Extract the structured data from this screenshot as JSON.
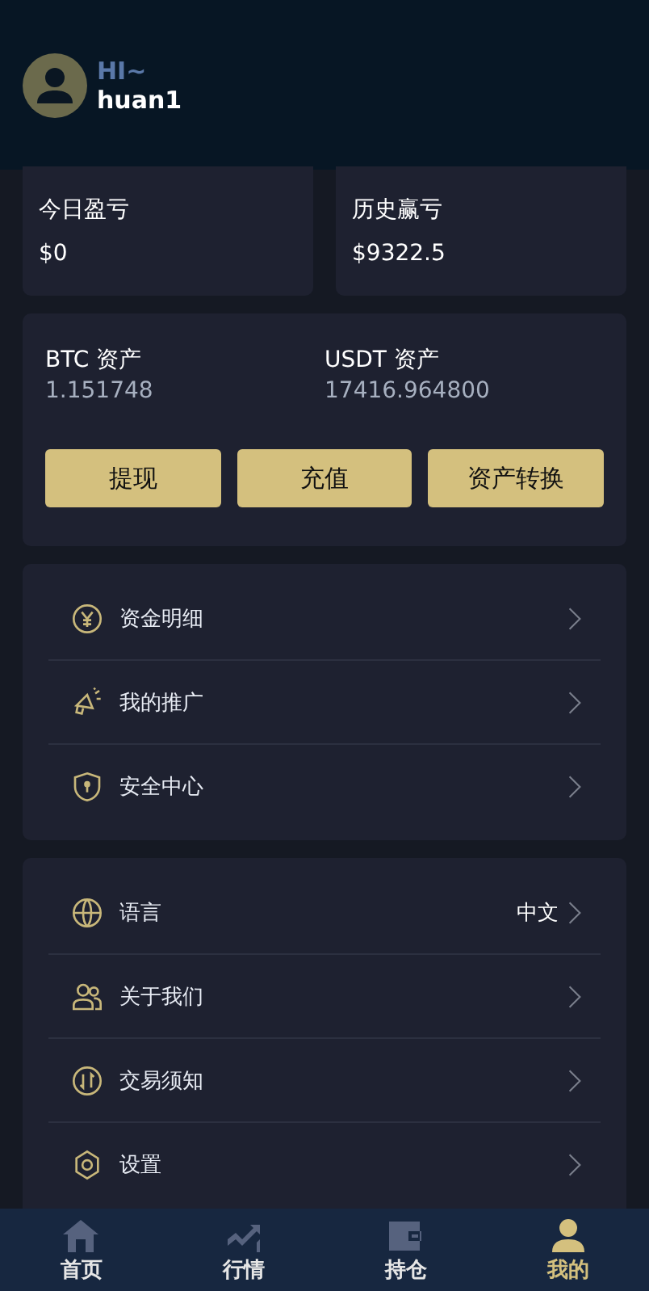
{
  "header": {
    "greeting": "HI~",
    "username": "huan1"
  },
  "stats": [
    {
      "label": "今日盈亏",
      "value": "$0"
    },
    {
      "label": "历史赢亏",
      "value": "$9322.5"
    }
  ],
  "assets": [
    {
      "label": "BTC 资产",
      "value": "1.151748"
    },
    {
      "label": "USDT 资产",
      "value": "17416.964800"
    }
  ],
  "actions": [
    "提现",
    "充值",
    "资产转换"
  ],
  "menu_groups": [
    [
      {
        "label": "资金明细"
      },
      {
        "label": "我的推广"
      },
      {
        "label": "安全中心"
      }
    ],
    [
      {
        "label": "语言",
        "value": "中文"
      },
      {
        "label": "关于我们"
      },
      {
        "label": "交易须知"
      },
      {
        "label": "设置"
      }
    ]
  ],
  "tabs": [
    {
      "label": "首页",
      "selected": false
    },
    {
      "label": "行情",
      "selected": false
    },
    {
      "label": "持仓",
      "selected": false
    },
    {
      "label": "我的",
      "selected": true
    }
  ]
}
